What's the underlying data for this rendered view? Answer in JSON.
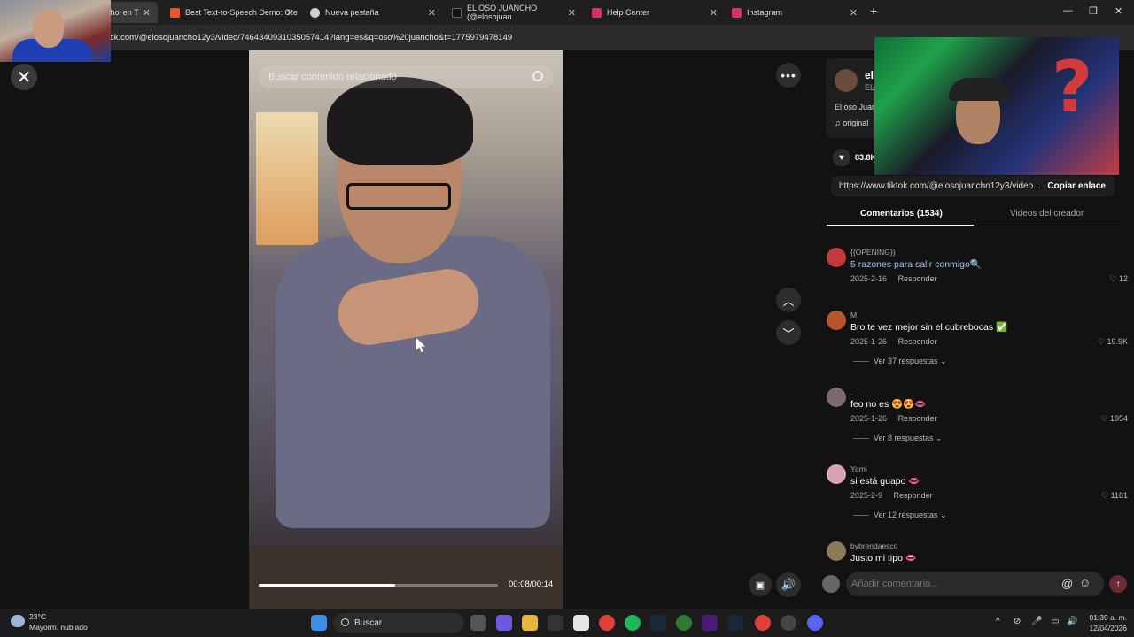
{
  "browser": {
    "tabs": [
      {
        "title": "cho' en T",
        "icon": "tiktok-icon",
        "color": "#3a3a3a"
      },
      {
        "title": "Best Text-to-Speech Demo: Cre",
        "icon": "tts-icon",
        "color": "#e8562a"
      },
      {
        "title": "Nueva pestaña",
        "icon": "chrome-icon",
        "color": "#cfcfcf"
      },
      {
        "title": "EL OSO JUANCHO (@elosojuan",
        "icon": "tiktok-icon",
        "color": "#111111"
      },
      {
        "title": "Help Center",
        "icon": "instagram-icon",
        "color": "#d6306e"
      },
      {
        "title": "Instagram",
        "icon": "instagram-icon",
        "color": "#d6306e"
      }
    ],
    "new_tab": "+",
    "url": "ck.com/@elosojuancho12y3/video/7464340931035057414?lang=es&q=oso%20juancho&t=1775979478149",
    "window_controls": {
      "minimize": "—",
      "restore": "❐",
      "close": "✕"
    }
  },
  "video": {
    "search_placeholder": "Buscar contenido relacionado",
    "time": "00:08/00:14",
    "progress": 0.57
  },
  "creator": {
    "name": "el",
    "handle": "EL",
    "description": "El oso Juan",
    "music": "♫  original"
  },
  "likes": "83.8K",
  "share": {
    "url": "https://www.tiktok.com/@elosojuancho12y3/video...",
    "copy_label": "Copiar enlace"
  },
  "tabs": {
    "comments": "Comentarios (1534)",
    "creator_videos": "Videos del creador"
  },
  "comments": [
    {
      "user": "{{OPENING}}",
      "text": "5 razones para salir conmigo🔍",
      "date": "2025-2-16",
      "reply": "Responder",
      "likes": "♡ 12",
      "replies": "",
      "avatar_color": "#c23a3a",
      "highlight": true
    },
    {
      "user": "M",
      "text": "Bro te vez mejor sin el cubrebocas ✅",
      "date": "2025-1-26",
      "reply": "Responder",
      "likes": "♡ 19.9K",
      "replies": "Ver 37 respuestas ⌄",
      "avatar_color": "#b5562e",
      "highlight": false
    },
    {
      "user": ".",
      "text": "feo no es 😍😍👄",
      "date": "2025-1-26",
      "reply": "Responder",
      "likes": "♡ 1954",
      "replies": "Ver 8 respuestas ⌄",
      "avatar_color": "#7a6a6a",
      "highlight": false
    },
    {
      "user": "Yami",
      "text": "si está guapo 👄",
      "date": "2025-2-9",
      "reply": "Responder",
      "likes": "♡ 1181",
      "replies": "Ver 12 respuestas ⌄",
      "avatar_color": "#d9a3b3",
      "highlight": false
    },
    {
      "user": "bybrendaesco",
      "text": "Justo mi tipo 👄",
      "date": "",
      "reply": "",
      "likes": "",
      "replies": "",
      "avatar_color": "#8a7a5a",
      "highlight": false
    }
  ],
  "comment_input": {
    "placeholder": "Añadir comentario...",
    "mention": "@",
    "emoji": "☺",
    "send": "↑"
  },
  "taskbar": {
    "temperature": "23°C",
    "weather": "Mayorm. nublado",
    "search": "Buscar",
    "time": "01:39 a. m.",
    "date": "12/04/2026",
    "tray_icons": [
      "^",
      "⊘",
      "🎤",
      "▭",
      "🔊"
    ]
  }
}
